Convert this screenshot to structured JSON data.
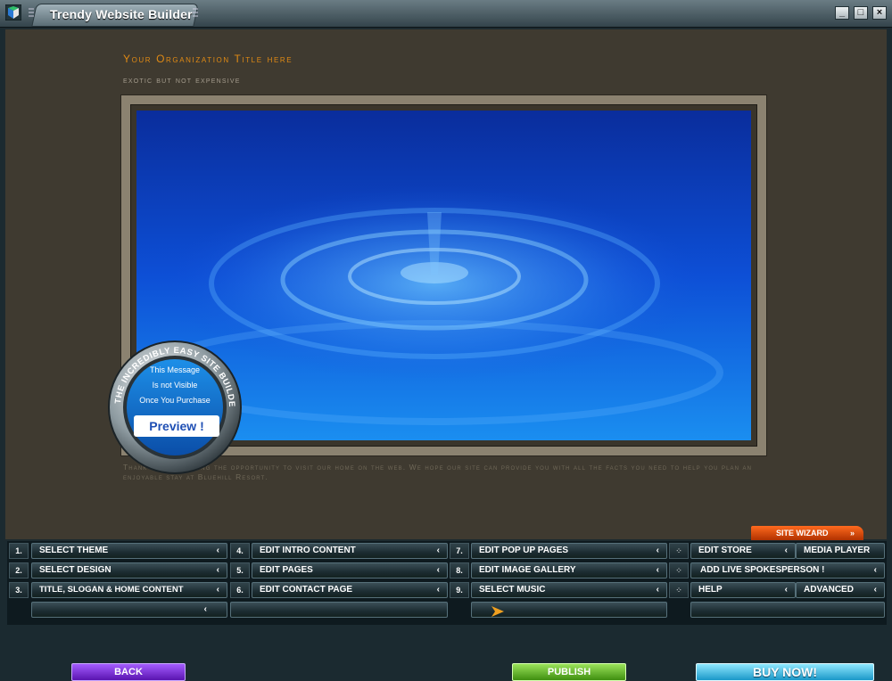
{
  "window": {
    "title": "Trendy Website Builder",
    "minimize_glyph": "_",
    "maximize_glyph": "□",
    "close_glyph": "×"
  },
  "site": {
    "org_title": "Your Organization Title here",
    "slogan": "exotic but not expensive",
    "intro_text": "Thank you for taking the opportunity to visit our home on the web. We hope our site can provide you with all the facts you need to help you plan an enjoyable stay at Bluehill Resort."
  },
  "badge": {
    "ring_text": "THE INCREDIBLY EASY SITE BUILDER!",
    "line1": "This Message",
    "line2": "Is not Visible",
    "line3": "Once You Purchase",
    "preview": "Preview !"
  },
  "site_wizard": {
    "label": "SITE WIZARD",
    "chevrons": "»"
  },
  "menu": {
    "col1": [
      {
        "num": "1.",
        "label": "SELECT THEME"
      },
      {
        "num": "2.",
        "label": "SELECT DESIGN"
      },
      {
        "num": "3.",
        "label": "TITLE, SLOGAN & HOME CONTENT"
      }
    ],
    "col2": [
      {
        "num": "4.",
        "label": "EDIT INTRO CONTENT"
      },
      {
        "num": "5.",
        "label": "EDIT PAGES"
      },
      {
        "num": "6.",
        "label": "EDIT CONTACT PAGE"
      }
    ],
    "col3": [
      {
        "num": "7.",
        "label": "EDIT POP UP PAGES"
      },
      {
        "num": "8.",
        "label": "EDIT IMAGE GALLERY"
      },
      {
        "num": "9.",
        "label": "SELECT MUSIC"
      }
    ],
    "col4": [
      {
        "label": "EDIT STORE",
        "extra": "MEDIA PLAYER"
      },
      {
        "label": "ADD LIVE SPOKESPERSON !",
        "extra": ""
      },
      {
        "label": "HELP",
        "extra": "ADVANCED"
      }
    ],
    "chevron": "‹",
    "back": "BACK",
    "publish": "PUBLISH",
    "buy_now": "BUY NOW!"
  },
  "colors": {
    "accent_orange": "#e08a14",
    "back_purple": "#7a28d6",
    "publish_green": "#5fb51c",
    "buy_cyan": "#35c0e0"
  }
}
